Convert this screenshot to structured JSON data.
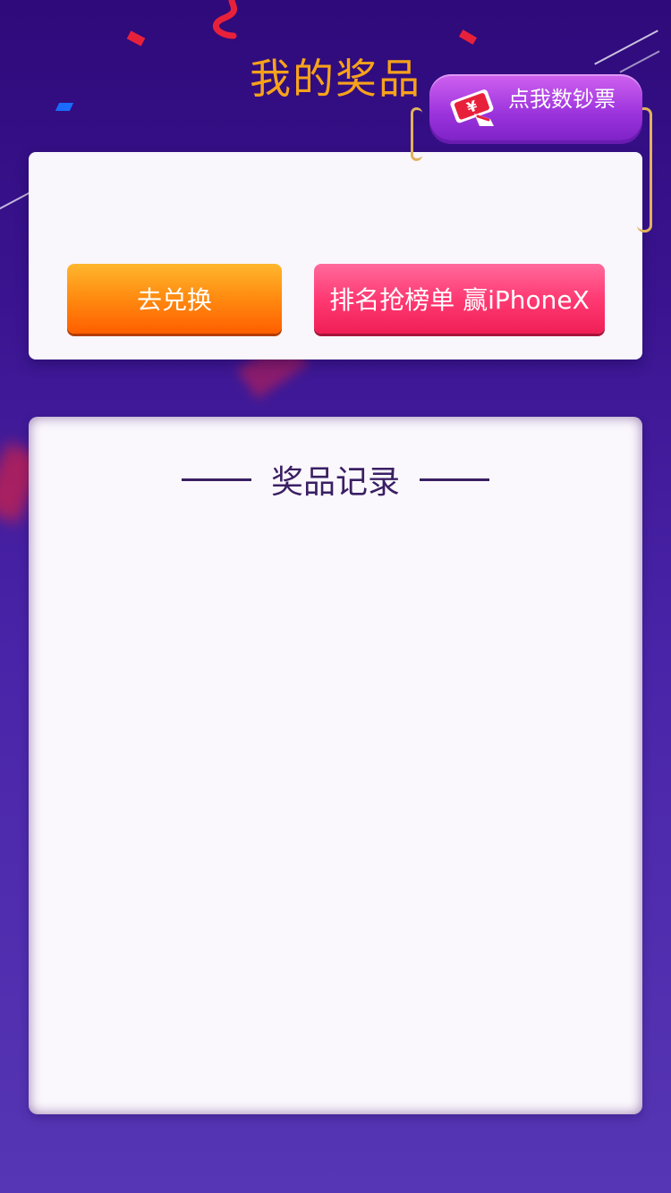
{
  "page": {
    "title": "我的奖品"
  },
  "badge": {
    "label": "点我数钞票",
    "icon": "money-bill-icon"
  },
  "actions": {
    "exchange_label": "去兑换",
    "rank_label": "排名抢榜单 赢iPhoneX"
  },
  "records": {
    "heading": "奖品记录",
    "items": []
  },
  "colors": {
    "background_top": "#2e0a7a",
    "background_bottom": "#5636b4",
    "title": "#f7a21b",
    "exchange_button": "#ff8a10",
    "rank_button": "#ff3a73",
    "badge": "#9b33dc",
    "heading_text": "#3a1f63"
  }
}
